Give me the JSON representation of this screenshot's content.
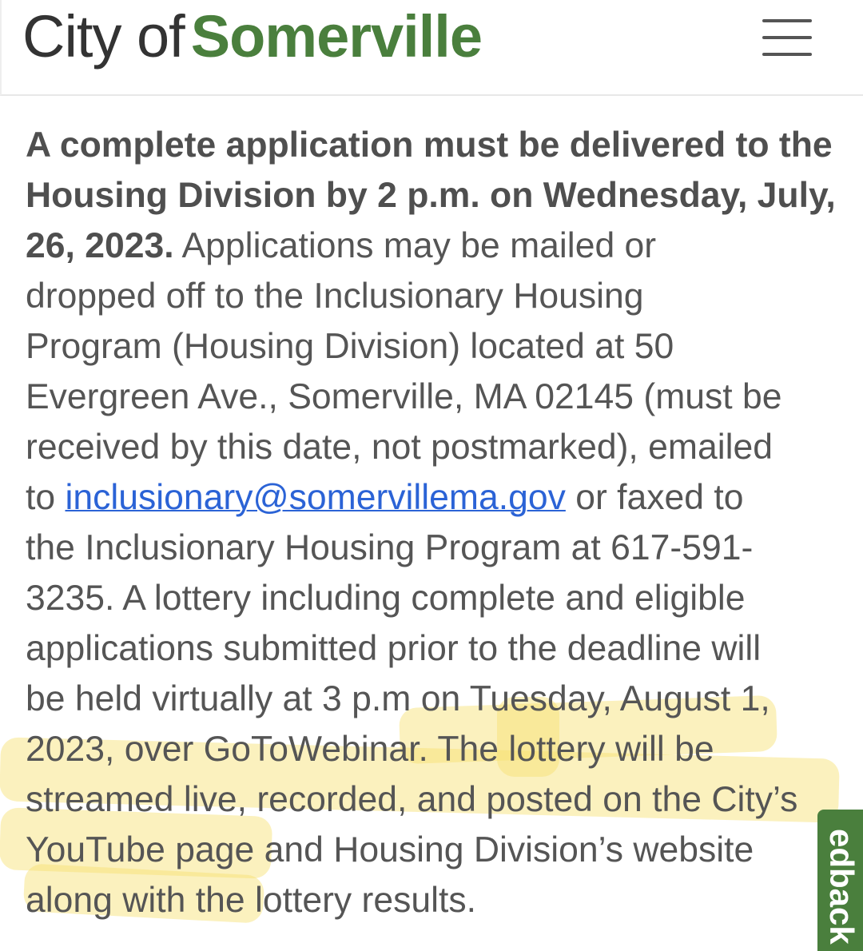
{
  "header": {
    "logo_prefix": "City of",
    "logo_brand": "Somerville",
    "menu_icon": "hamburger-menu-icon"
  },
  "content": {
    "lines": [
      {
        "bold": "A complete application must be delivered to the"
      },
      {
        "bold": "Housing Division by 2 p.m. on Wednesday, July,"
      },
      {
        "bold": "26, 2023.",
        "text": " Applications may be mailed or"
      },
      {
        "text": "dropped off to the Inclusionary Housing"
      },
      {
        "text": "Program (Housing Division) located at 50"
      },
      {
        "text": "Evergreen Ave., Somerville, MA 02145 (must be"
      },
      {
        "text": "received by this date, not postmarked), emailed"
      },
      {
        "text": "to ",
        "link": "inclusionary@somervillema.gov",
        "after": " or faxed to"
      },
      {
        "text": "the Inclusionary Housing Program at 617-591-"
      },
      {
        "text": "3235. A lottery including complete and eligible"
      },
      {
        "text": "applications submitted prior to the deadline will"
      },
      {
        "text": "be held virtually at 3 p.m on Tuesday, August 1,"
      },
      {
        "text": "2023, over GoToWebinar. The lottery will be"
      },
      {
        "text": "streamed live, recorded, and posted on the City’s"
      },
      {
        "text": "YouTube page and Housing Division’s website"
      },
      {
        "text": "along with the lottery results."
      }
    ]
  },
  "feedback": {
    "label": "edback"
  },
  "colors": {
    "brand_green": "#4a7f3d",
    "link_blue": "#2b63d6",
    "body_text": "#555555",
    "highlight": "#f7df6e"
  }
}
